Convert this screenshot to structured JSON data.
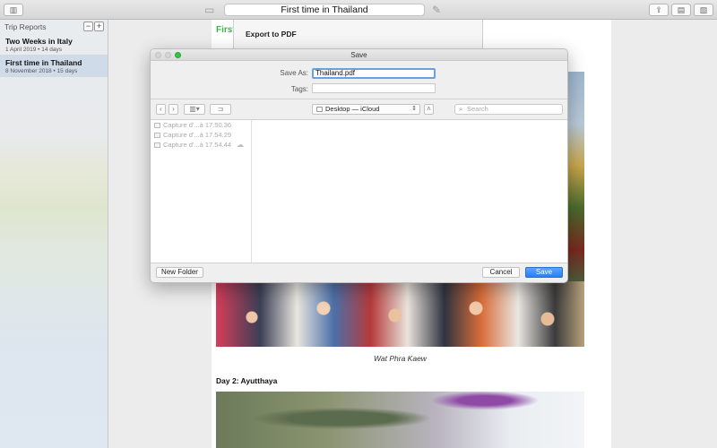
{
  "window": {
    "title": "First time in Thailand"
  },
  "sidebar": {
    "header": "Trip Reports",
    "add_label": "+",
    "remove_label": "−",
    "items": [
      {
        "name": "Two Weeks in Italy",
        "meta": "1 April 2019 • 14 days"
      },
      {
        "name": "First time in Thailand",
        "meta": "8 November 2018 • 15 days"
      }
    ]
  },
  "document": {
    "title_partial": "First",
    "caption": "Wat Phra Kaew",
    "section_heading": "Day 2: Ayutthaya"
  },
  "export_sheet": {
    "label": "Export to PDF"
  },
  "save_dialog": {
    "title": "Save",
    "save_as_label": "Save As:",
    "save_as_value": "Thailand.pdf",
    "tags_label": "Tags:",
    "location": "Desktop — iCloud",
    "search_placeholder": "Search",
    "files": [
      {
        "name": "Capture d'...à 17.50.36"
      },
      {
        "name": "Capture d'...à 17.54.29"
      },
      {
        "name": "Capture d'...à 17.54.44"
      }
    ],
    "new_folder_label": "New Folder",
    "cancel_label": "Cancel",
    "save_label": "Save"
  },
  "colors": {
    "accent_blue": "#2c7ef0",
    "title_green": "#3bb34a",
    "sidebar_selected": "#cfdbe8"
  }
}
